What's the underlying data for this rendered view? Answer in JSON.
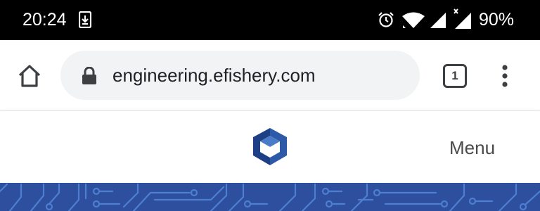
{
  "status_bar": {
    "time": "20:24",
    "battery_percent": "90%",
    "icons": [
      "download-icon",
      "alarm-icon",
      "wifi-icon",
      "signal-icon",
      "signal-icon"
    ]
  },
  "browser": {
    "url": "engineering.efishery.com",
    "tab_count": "1",
    "icons": [
      "home-icon",
      "lock-icon",
      "more-vert-icon"
    ]
  },
  "site": {
    "menu_label": "Menu",
    "logo_colors": [
      "#2d5aa8",
      "#1d3f86",
      "#4a7bc8"
    ]
  },
  "colors": {
    "status_bar_bg": "#000000",
    "url_bar_bg": "#f1f3f4",
    "hero_bg": "#2e4f9e",
    "hero_circuit": "#4d7fd1"
  }
}
